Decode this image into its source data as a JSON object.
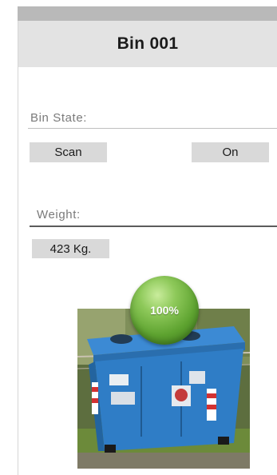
{
  "header": {
    "title": "Bin 001"
  },
  "bin_state": {
    "label": "Bin State:",
    "scan_button": "Scan",
    "power_button": "On"
  },
  "weight": {
    "label": "Weight:",
    "value": "423 Kg."
  },
  "fill": {
    "label": "100%",
    "level_fraction": 1.0
  },
  "colors": {
    "header_bg": "#e3e3e3",
    "button_bg": "#d9d9d9",
    "fill_badge": "#5ea330",
    "bin_body": "#2f7dc6"
  }
}
